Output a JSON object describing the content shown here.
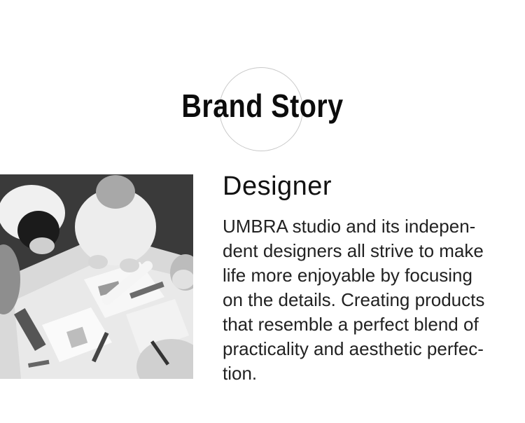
{
  "title": "Brand Story",
  "section": {
    "heading": "Designer",
    "lines": [
      "UMBRA studio and its indepen-",
      "dent designers all strive to make",
      "life more enjoyable by focusing",
      "on the details. Creating products",
      "that resemble a perfect blend of",
      "practicality and aesthetic perfec-",
      "tion."
    ]
  },
  "photo": {
    "subject": "team-of-designers-at-table",
    "tone": "grayscale"
  },
  "colors": {
    "text": "#111111",
    "ring": "#c9c9c9",
    "background": "#ffffff"
  }
}
